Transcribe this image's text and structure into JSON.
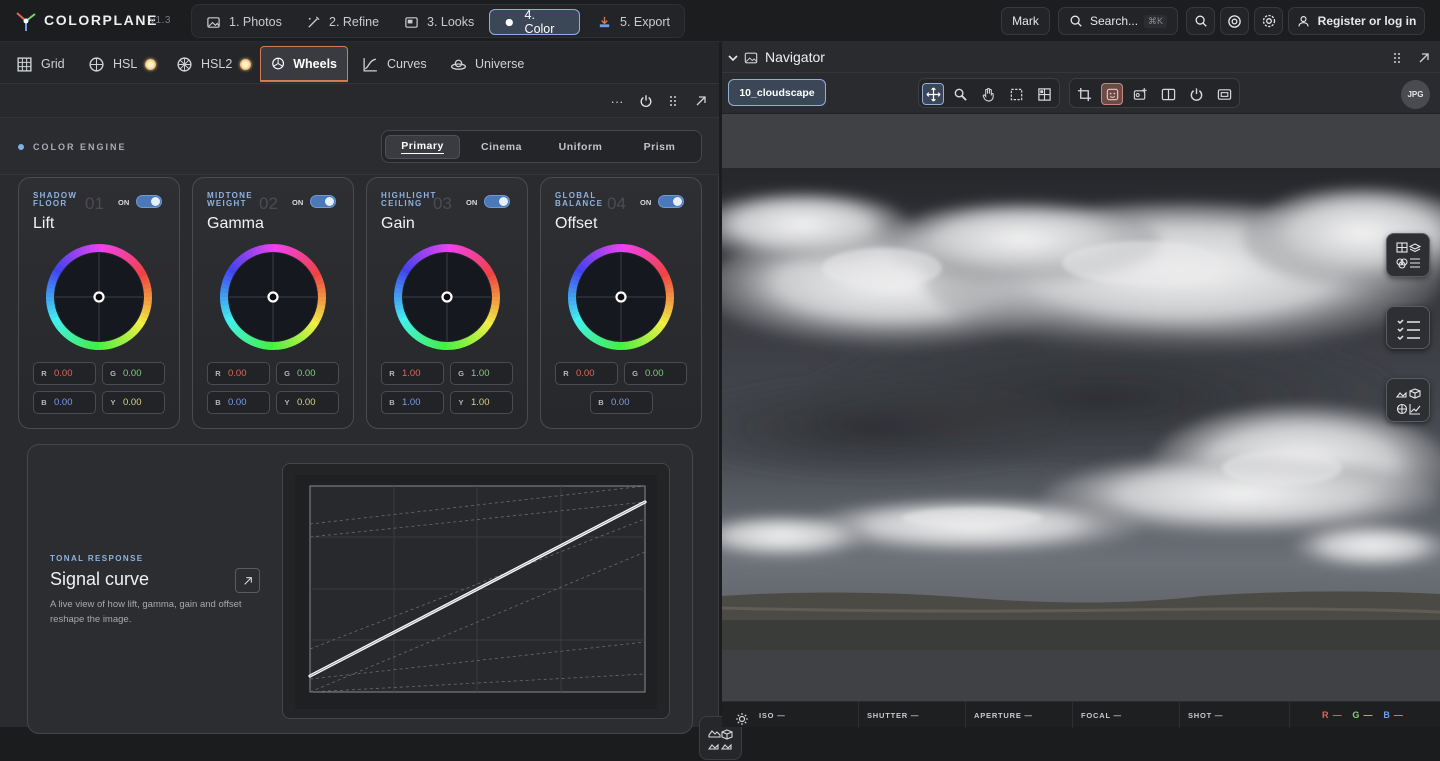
{
  "app": {
    "name": "COLORPLANE",
    "version": "v1.3"
  },
  "steps": [
    {
      "label": "1. Photos"
    },
    {
      "label": "2. Refine"
    },
    {
      "label": "3. Looks"
    },
    {
      "label": "4. Color",
      "active": true
    },
    {
      "label": "5. Export"
    }
  ],
  "topbar": {
    "user": "Mark",
    "search_label": "Search...",
    "search_shortcut": "⌘K",
    "register_label": "Register or log in"
  },
  "tabs": [
    {
      "label": "Grid"
    },
    {
      "label": "HSL"
    },
    {
      "label": "HSL2"
    },
    {
      "label": "Wheels",
      "active": true
    },
    {
      "label": "Curves"
    },
    {
      "label": "Universe"
    }
  ],
  "toolrow": {
    "more": "···"
  },
  "engine": {
    "label": "COLOR ENGINE",
    "modes": [
      "Primary",
      "Cinema",
      "Uniform",
      "Prism"
    ],
    "active_mode": "Primary"
  },
  "wheels": [
    {
      "sub": "SHADOW FLOOR",
      "num": "01",
      "on": "ON",
      "title": "Lift",
      "fields": [
        {
          "l": "R",
          "v": "0.00"
        },
        {
          "l": "G",
          "v": "0.00"
        },
        {
          "l": "B",
          "v": "0.00"
        },
        {
          "l": "Y",
          "v": "0.00"
        }
      ]
    },
    {
      "sub": "MIDTONE WEIGHT",
      "num": "02",
      "on": "ON",
      "title": "Gamma",
      "fields": [
        {
          "l": "R",
          "v": "0.00"
        },
        {
          "l": "G",
          "v": "0.00"
        },
        {
          "l": "B",
          "v": "0.00"
        },
        {
          "l": "Y",
          "v": "0.00"
        }
      ]
    },
    {
      "sub": "HIGHLIGHT CEILING",
      "num": "03",
      "on": "ON",
      "title": "Gain",
      "fields": [
        {
          "l": "R",
          "v": "1.00"
        },
        {
          "l": "G",
          "v": "1.00"
        },
        {
          "l": "B",
          "v": "1.00"
        },
        {
          "l": "Y",
          "v": "1.00"
        }
      ]
    },
    {
      "sub": "GLOBAL BALANCE",
      "num": "04",
      "on": "ON",
      "title": "Offset",
      "fields": [
        {
          "l": "R",
          "v": "0.00"
        },
        {
          "l": "G",
          "v": "0.00"
        },
        {
          "l": "B",
          "v": "0.00"
        }
      ]
    }
  ],
  "signal": {
    "sub": "TONAL RESPONSE",
    "title": "Signal curve",
    "desc": "A live view of how lift, gamma, gain and offset reshape the image."
  },
  "navigator": {
    "title": "Navigator",
    "file_chip": "10_cloudscape",
    "format_badge": "JPG"
  },
  "exif": [
    {
      "label": "ISO —"
    },
    {
      "label": "SHUTTER —"
    },
    {
      "label": "APERTURE —"
    },
    {
      "label": "FOCAL —"
    },
    {
      "label": "SHOT —"
    }
  ],
  "rgb": [
    {
      "label": "R —",
      "color": "#e0665c"
    },
    {
      "label": "G —",
      "color": "#7ed07a"
    },
    {
      "label": "B —",
      "color": "#6f9de8"
    }
  ],
  "colors": {
    "accent": "#8fb0d8",
    "active_tab": "#d27b5a",
    "red": "#e0665c",
    "green": "#7ed07a",
    "blue": "#7b9cf0",
    "yellow": "#e0d07a"
  }
}
